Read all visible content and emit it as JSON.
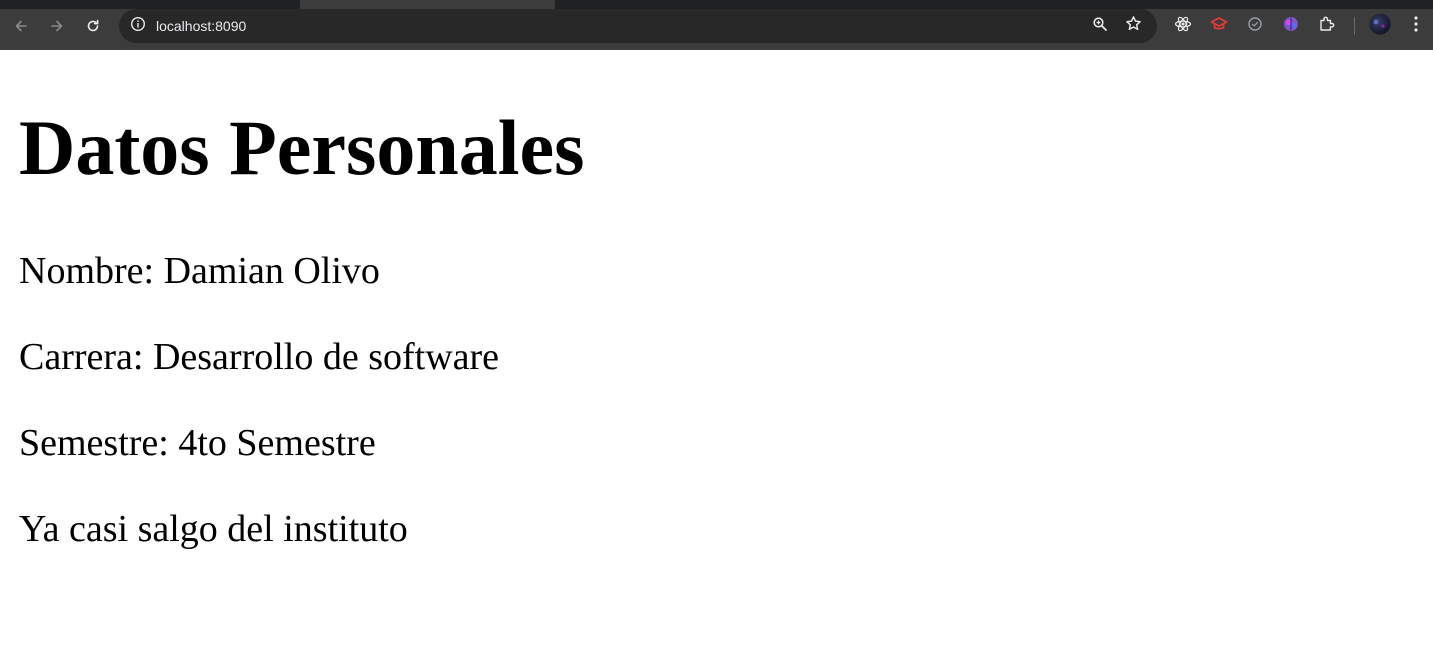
{
  "browser": {
    "url": "localhost:8090",
    "icons": {
      "back": "arrow-left-icon",
      "forward": "arrow-right-icon",
      "reload": "reload-icon",
      "site_info": "info-icon",
      "zoom": "zoom-icon",
      "bookmark": "star-icon",
      "extension_1": "react-icon",
      "extension_2": "graduation-cap-icon",
      "extension_3": "circle-check-icon",
      "extension_4": "brain-icon",
      "extensions_menu": "puzzle-icon",
      "profile": "avatar",
      "menu": "kebab-menu-icon"
    },
    "colors": {
      "chrome_bg": "#3c3c3c",
      "omnibox_bg": "#282828",
      "icon_light": "#e8eaed",
      "icon_disabled": "#8a8a8a",
      "extension_red": "#e53935",
      "extension_purple": "#7e57c2"
    }
  },
  "page": {
    "heading": "Datos Personales",
    "lines": [
      "Nombre: Damian Olivo",
      "Carrera: Desarrollo de software",
      "Semestre: 4to Semestre",
      "Ya casi salgo del instituto"
    ]
  }
}
